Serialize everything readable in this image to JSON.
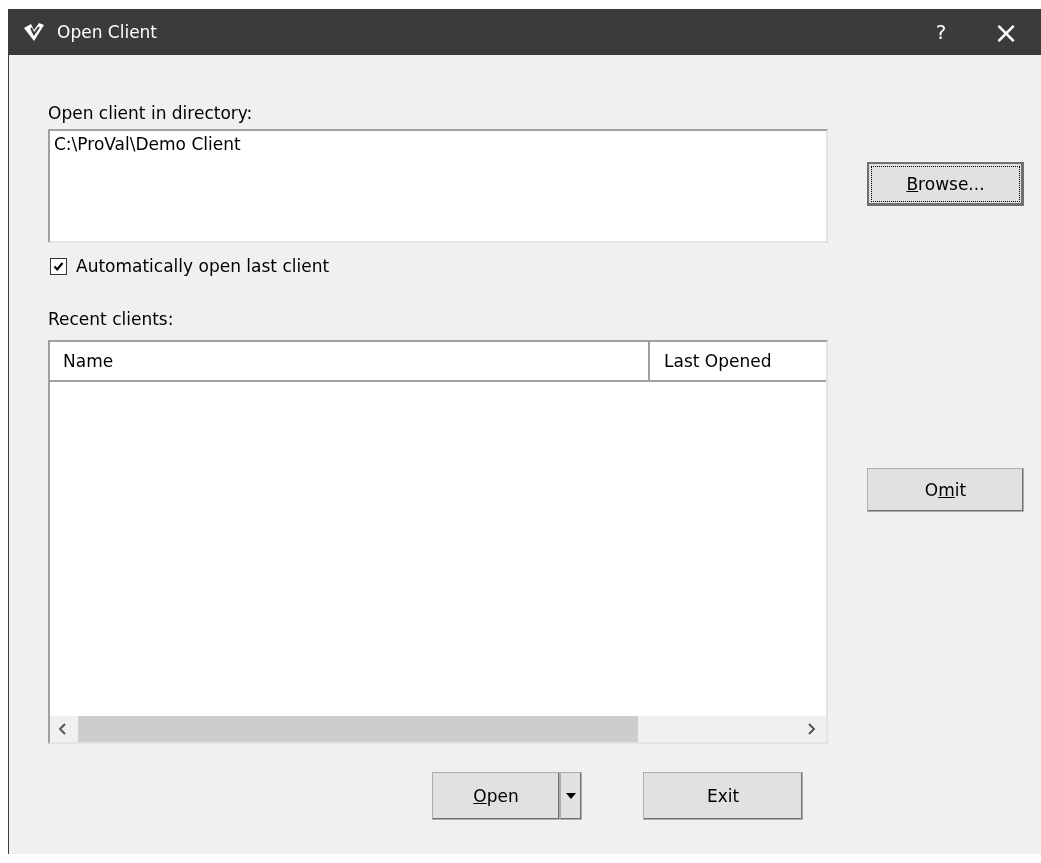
{
  "window": {
    "title": "Open Client",
    "help_button": "?",
    "close_button": "×"
  },
  "directory": {
    "label": "Open client in directory:",
    "value": "C:\\ProVal\\Demo Client"
  },
  "browse_button": {
    "label": [
      {
        "text": "B",
        "underline": true
      },
      {
        "text": "rowse...",
        "underline": false
      }
    ],
    "focused": true
  },
  "auto_open": {
    "label": "Automatically open last client",
    "checked": true
  },
  "recent": {
    "label": "Recent clients:",
    "columns": [
      "Name",
      "Last Opened"
    ]
  },
  "omit_button": {
    "label": [
      {
        "text": "O",
        "underline": false
      },
      {
        "text": "m",
        "underline": true
      },
      {
        "text": "it",
        "underline": false
      }
    ]
  },
  "open_button": {
    "label": [
      {
        "text": "O",
        "underline": true
      },
      {
        "text": "pen",
        "underline": false
      }
    ]
  },
  "exit_button": {
    "label": "Exit"
  }
}
